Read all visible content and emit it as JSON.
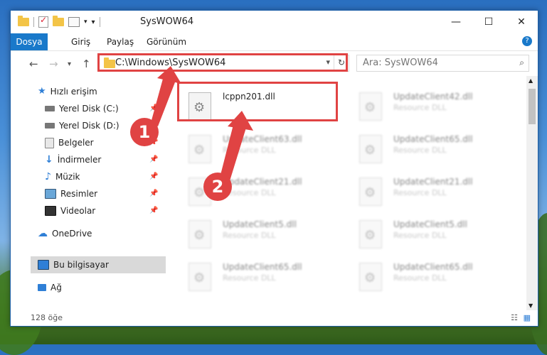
{
  "window": {
    "title": "SysWOW64"
  },
  "ribbon": {
    "tabs": [
      {
        "label": "Dosya",
        "active": true
      },
      {
        "label": "Giriş"
      },
      {
        "label": "Paylaş"
      },
      {
        "label": "Görünüm"
      }
    ],
    "help": "?"
  },
  "address": {
    "path": "C:\\Windows\\SysWOW64"
  },
  "search": {
    "placeholder": "Ara: SysWOW64"
  },
  "sidebar": {
    "items": [
      {
        "label": "Hızlı erişim",
        "icon": "star-icon"
      },
      {
        "label": "Yerel Disk (C:)",
        "icon": "drive-icon",
        "pinned": true
      },
      {
        "label": "Yerel Disk (D:)",
        "icon": "drive-icon",
        "pinned": true
      },
      {
        "label": "Belgeler",
        "icon": "documents-icon",
        "pinned": true
      },
      {
        "label": "İndirmeler",
        "icon": "download-icon",
        "pinned": true
      },
      {
        "label": "Müzik",
        "icon": "music-icon",
        "pinned": true
      },
      {
        "label": "Resimler",
        "icon": "pictures-icon",
        "pinned": true
      },
      {
        "label": "Videolar",
        "icon": "videos-icon",
        "pinned": true
      },
      {
        "label": "OneDrive",
        "icon": "cloud-icon"
      },
      {
        "label": "Bu bilgisayar",
        "icon": "computer-icon",
        "selected": true
      },
      {
        "label": "Ağ",
        "icon": "network-icon"
      }
    ]
  },
  "files": [
    {
      "name": "lcppn201.dll",
      "desc": ""
    },
    {
      "name": "UpdateClient42.dll",
      "desc": "Resource DLL"
    },
    {
      "name": "UpdateClient63.dll",
      "desc": "Resource DLL"
    },
    {
      "name": "UpdateClient65.dll",
      "desc": "Resource DLL"
    },
    {
      "name": "UpdateClient21.dll",
      "desc": "Resource DLL"
    },
    {
      "name": "UpdateClient21.dll",
      "desc": "Resource DLL"
    },
    {
      "name": "UpdateClient5.dll",
      "desc": "Resource DLL"
    },
    {
      "name": "UpdateClient5.dll",
      "desc": "Resource DLL"
    },
    {
      "name": "UpdateClient65.dll",
      "desc": "Resource DLL"
    },
    {
      "name": "UpdateClient65.dll",
      "desc": "Resource DLL"
    }
  ],
  "status": {
    "count": "128 öğe"
  },
  "callouts": {
    "one": "1",
    "two": "2"
  },
  "colors": {
    "accent": "#1979ca",
    "highlight": "#e04343",
    "folder": "#f3c447"
  }
}
